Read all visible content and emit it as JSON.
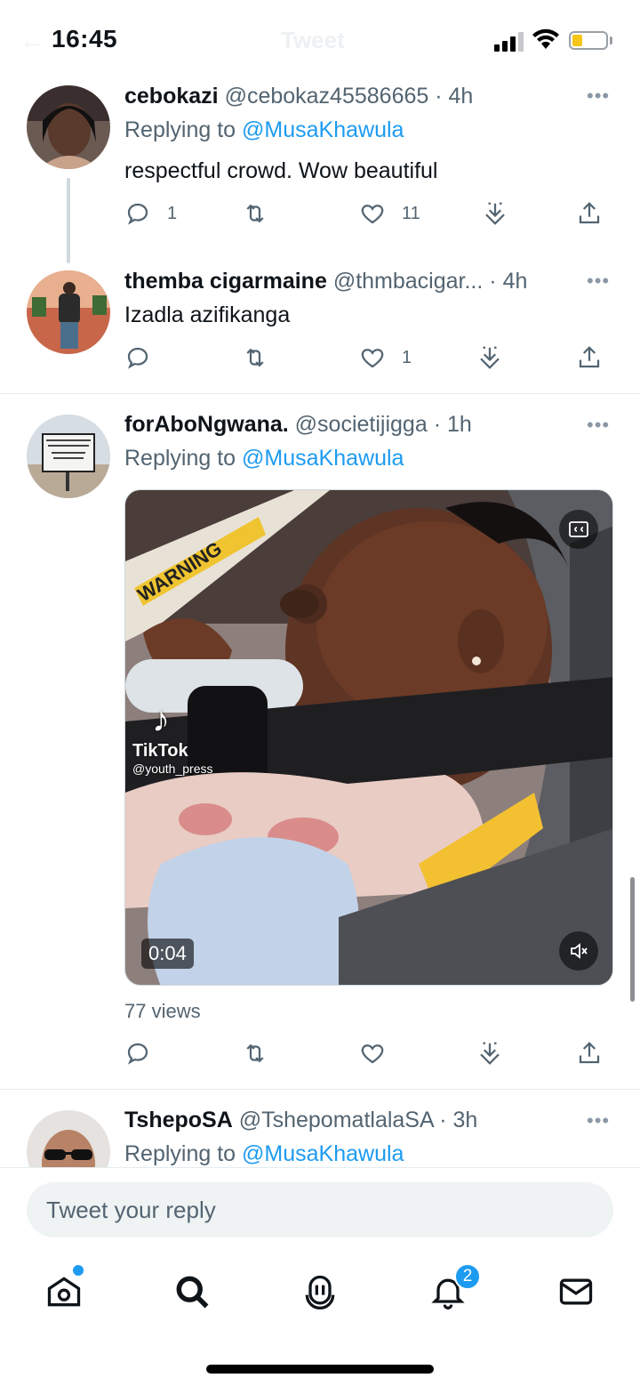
{
  "status_bar": {
    "time": "16:45",
    "battery_color": "#f5c518"
  },
  "header_ghost": {
    "title": "Tweet",
    "back_icon": "arrow-left-icon"
  },
  "tweets": [
    {
      "name": "cebokazi",
      "handle": "@cebokaz45586665",
      "separator": "·",
      "time": "4h",
      "replying_prefix": "Replying to",
      "replying_to": "@MusaKhawula",
      "text": "respectful crowd. Wow beautiful",
      "counts": {
        "reply": "1",
        "retweet": "",
        "like": "11"
      }
    },
    {
      "name": "themba cigarmaine",
      "handle": "@thmbacigar...",
      "separator": "·",
      "time": "4h",
      "text": "Izadla azifikanga",
      "counts": {
        "reply": "",
        "retweet": "",
        "like": "1"
      }
    },
    {
      "name": "forAboNgwana.",
      "handle": "@societijigga",
      "separator": "·",
      "time": "1h",
      "replying_prefix": "Replying to",
      "replying_to": "@MusaKhawula",
      "avatar_sign": "GOD HAS ALREADY PREPARED THE WAY. HE'S JUST PREPARING YOU.",
      "video": {
        "duration": "0:04",
        "watermark_brand": "TikTok",
        "watermark_user": "@youth_press",
        "sticker_text": "WARNING"
      },
      "views": "77 views",
      "counts": {
        "reply": "",
        "retweet": "",
        "like": ""
      }
    },
    {
      "name": "TshepoSA",
      "handle": "@TshepomatlalaSA",
      "separator": "·",
      "time": "3h",
      "replying_prefix": "Replying to",
      "replying_to": "@MusaKhawula"
    }
  ],
  "composer": {
    "placeholder": "Tweet your reply"
  },
  "tabbar": {
    "items": [
      "home-icon",
      "search-icon",
      "spaces-icon",
      "notifications-icon",
      "messages-icon"
    ],
    "notifications_badge": "2"
  },
  "colors": {
    "accent": "#1d9bf0",
    "secondary_text": "#536471"
  }
}
